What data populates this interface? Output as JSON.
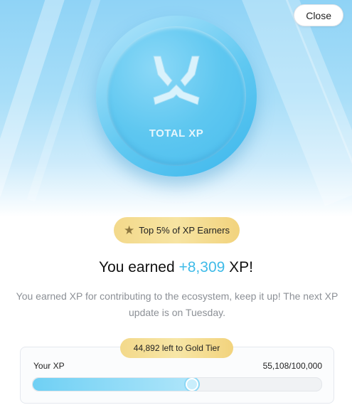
{
  "header": {
    "close_label": "Close"
  },
  "coin": {
    "label": "TOTAL XP",
    "icon": "trident-logo-icon"
  },
  "rank_badge": {
    "icon": "star-icon",
    "text": "Top 5% of XP Earners"
  },
  "headline": {
    "prefix": "You earned ",
    "amount": "+8,309",
    "suffix": " XP!"
  },
  "description": "You earned XP for contributing to the ecosystem, keep it up! The next XP update is on Tuesday.",
  "progress": {
    "tag": "44,892 left to Gold Tier",
    "label": "Your XP",
    "value_text": "55,108/100,000",
    "current": 55108,
    "target": 100000
  },
  "colors": {
    "accent": "#3fbbe8",
    "gold": "#f3d98b",
    "coin": "#5ec7f0"
  }
}
